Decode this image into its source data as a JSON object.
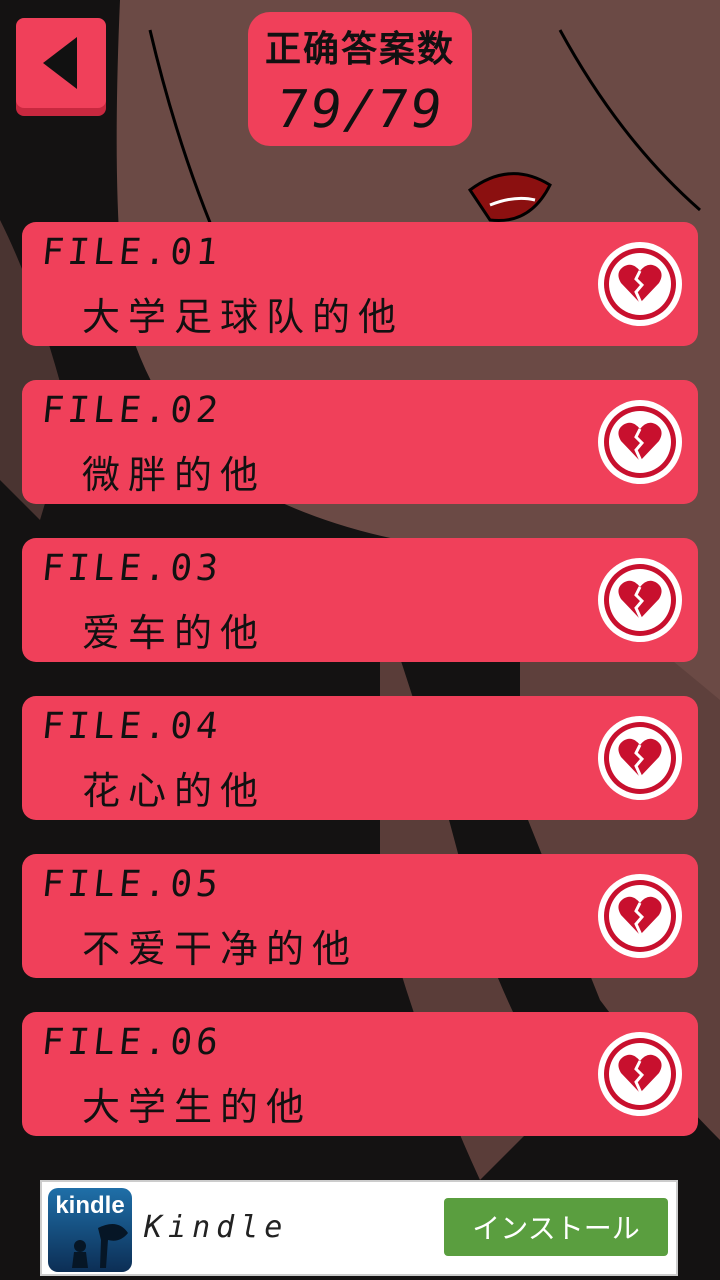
{
  "header": {
    "score_title": "正确答案数",
    "score_value": "79/79"
  },
  "files": [
    {
      "num": "FILE.01",
      "name": "大学足球队的他",
      "icon": "broken-heart-icon"
    },
    {
      "num": "FILE.02",
      "name": "微胖的他",
      "icon": "broken-heart-icon"
    },
    {
      "num": "FILE.03",
      "name": "爱车的他",
      "icon": "broken-heart-icon"
    },
    {
      "num": "FILE.04",
      "name": "花心的他",
      "icon": "broken-heart-icon"
    },
    {
      "num": "FILE.05",
      "name": "不爱干净的他",
      "icon": "broken-heart-icon"
    },
    {
      "num": "FILE.06",
      "name": "大学生的他",
      "icon": "broken-heart-icon"
    }
  ],
  "ad": {
    "logo_text": "kindle",
    "title": "Kindle",
    "install_label": "インストール"
  },
  "colors": {
    "accent": "#f0405a",
    "heart": "#c8102e",
    "install": "#5a9e3f"
  }
}
